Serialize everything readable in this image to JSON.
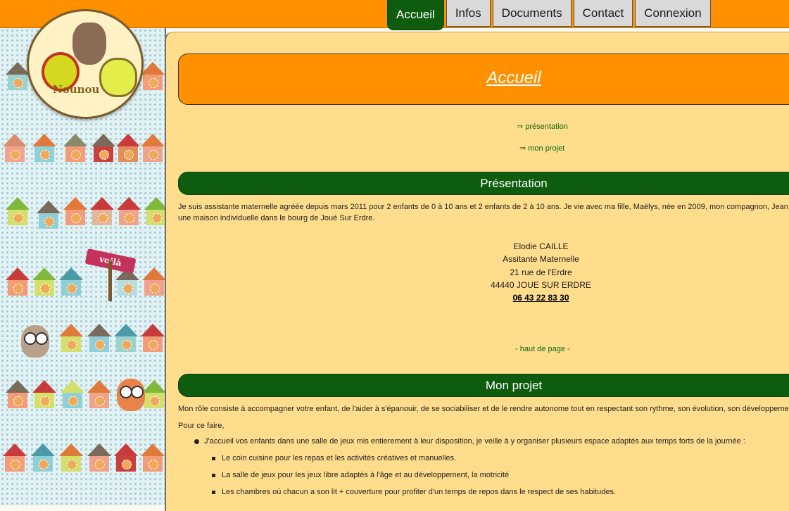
{
  "nav": {
    "tabs": [
      "Accueil",
      "Infos",
      "Documents",
      "Contact",
      "Connexion"
    ],
    "active": "Accueil"
  },
  "logo": {
    "name": "Nounou"
  },
  "sidebar": {
    "sign_text": "voilà"
  },
  "banner": {
    "title": "Accueil"
  },
  "anchors": {
    "presentation": "⇒ présentation",
    "projet": "⇒ mon projet",
    "top": "- haut de page -"
  },
  "presentation": {
    "heading": "Présentation",
    "text_line1": "Je suis assistante maternelle agréée depuis mars 2011 pour 2 enfants de 0 à 10 ans et 2 enfants de 2 à 10 ans. Je vie avec ma fille, Maëlys, née en 2009, mon compagnon, Jean Christoph",
    "text_line2": "une maison individuelle dans le bourg de Joué Sur Erdre.",
    "address": {
      "name": "Elodie CAILLE",
      "role": "Assitante Maternelle",
      "street": "21 rue de l'Erdre",
      "city": "44440 JOUE SUR ERDRE",
      "phone": "06 43 22 83 30"
    }
  },
  "projet": {
    "heading": "Mon projet",
    "text_line1": "Mon rôle consiste à accompagner votre enfant, de l'aider à s'épanouir, de se sociabiliser et de le rendre autonome tout en respectant son rythme, son évolution, son développement et sa s",
    "intro": "Pour ce faire,",
    "item1": "J'accueil vos enfants dans une salle de jeux mis entierement à leur disposition, je veille à y organiser plusieurs espace adaptés aux temps forts de la journée :",
    "subitems": [
      "Le coin cuisine pour les repas et les activités créatives et manuelles.",
      "La salle de jeux pour les jeux libre adaptés à l'âge et au développement, la motricité",
      "Les chambres où chacun a son lit + couverture pour profiter d'un temps de repos dans le respect de ses habitudes."
    ]
  },
  "colors": {
    "orange": "#ff9000",
    "green": "#0e5c0e",
    "content_bg": "#ffdd8d"
  }
}
